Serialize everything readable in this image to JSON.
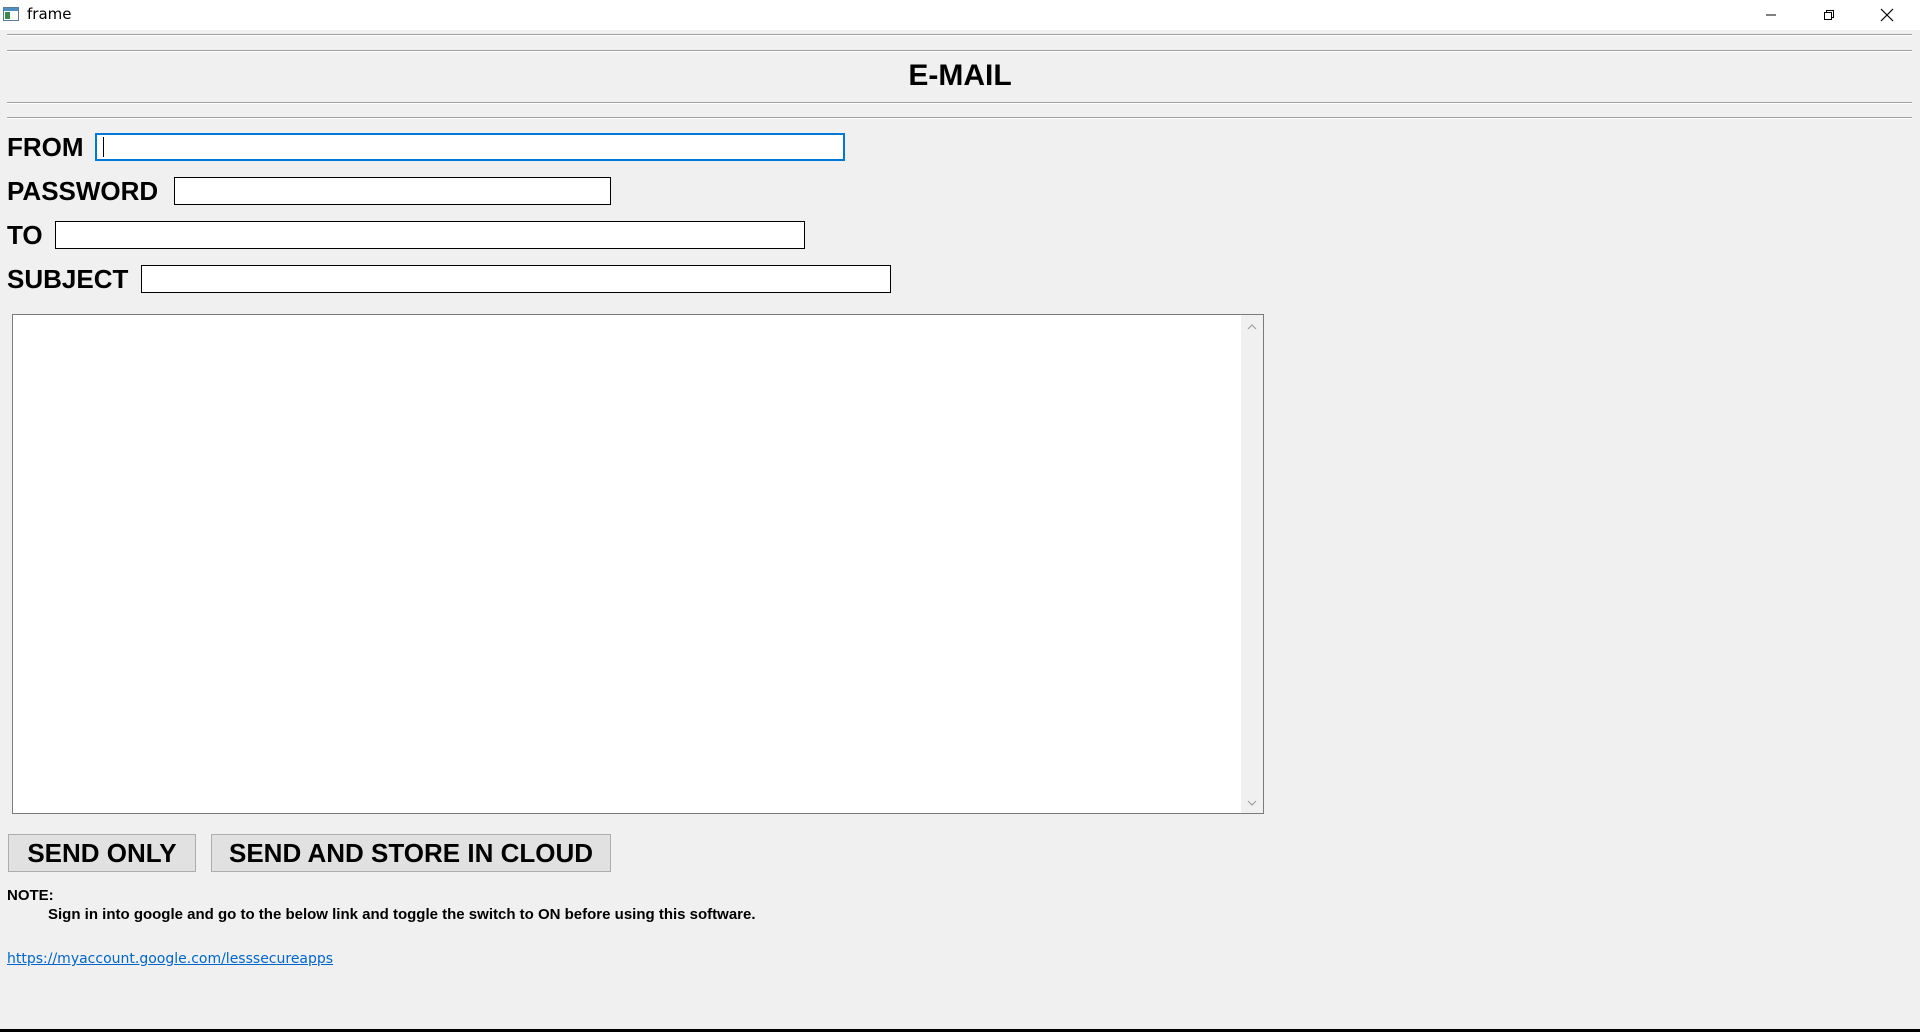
{
  "window": {
    "title": "frame",
    "icon": "app-window-icon"
  },
  "controls": {
    "minimize": "minimize-icon",
    "maximize": "restore-icon",
    "close": "close-icon"
  },
  "heading": "E-MAIL",
  "form": {
    "from_label": "FROM",
    "from_value": "",
    "password_label": "PASSWORD",
    "password_value": "",
    "to_label": "TO",
    "to_value": "",
    "subject_label": "SUBJECT",
    "subject_value": "",
    "message_value": ""
  },
  "buttons": {
    "send_only": "SEND ONLY",
    "send_and_store": "SEND AND STORE IN CLOUD"
  },
  "note": {
    "label": "NOTE:",
    "text": "Sign in into google and go to the below link and toggle the switch to ON before using this software.",
    "link": "https://myaccount.google.com/lesssecureapps"
  },
  "colors": {
    "focus": "#0078d7",
    "link": "#0066cc",
    "background": "#f0f0f0"
  }
}
